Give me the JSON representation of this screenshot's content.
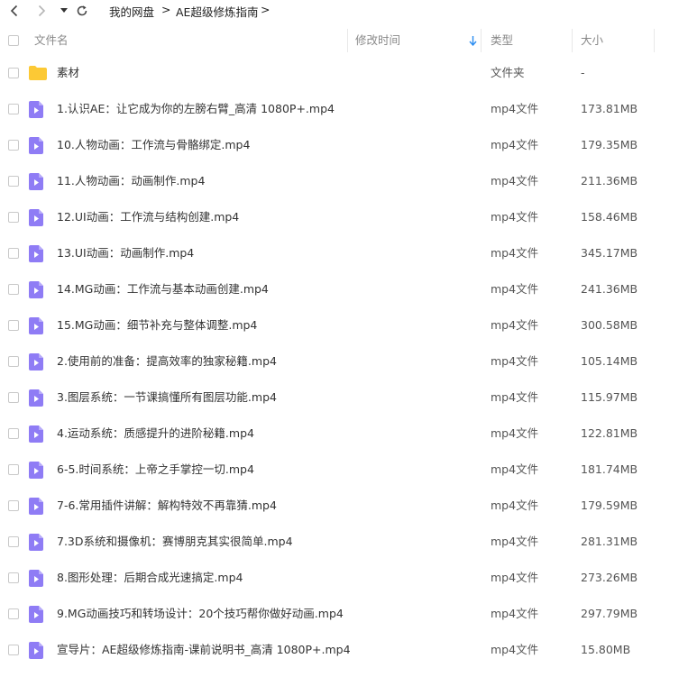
{
  "breadcrumb": [
    "我的网盘",
    "AE超级修炼指南"
  ],
  "breadcrumb_sep": ">",
  "columns": {
    "name": "文件名",
    "modified": "修改时间",
    "type": "类型",
    "size": "大小"
  },
  "accent_color": "#2a8cf0",
  "video_icon_color": "#8f7cf5",
  "folder_icon_color": "#fcc935",
  "rows": [
    {
      "icon": "folder-icon",
      "name": "素材",
      "type": "文件夹",
      "size": "-"
    },
    {
      "icon": "video-file-icon",
      "name": "1.认识AE：让它成为你的左膀右臂_高清 1080P+.mp4",
      "type": "mp4文件",
      "size": "173.81MB"
    },
    {
      "icon": "video-file-icon",
      "name": "10.人物动画：工作流与骨骼绑定.mp4",
      "type": "mp4文件",
      "size": "179.35MB"
    },
    {
      "icon": "video-file-icon",
      "name": "11.人物动画：动画制作.mp4",
      "type": "mp4文件",
      "size": "211.36MB"
    },
    {
      "icon": "video-file-icon",
      "name": "12.UI动画：工作流与结构创建.mp4",
      "type": "mp4文件",
      "size": "158.46MB"
    },
    {
      "icon": "video-file-icon",
      "name": "13.UI动画：动画制作.mp4",
      "type": "mp4文件",
      "size": "345.17MB"
    },
    {
      "icon": "video-file-icon",
      "name": "14.MG动画：工作流与基本动画创建.mp4",
      "type": "mp4文件",
      "size": "241.36MB"
    },
    {
      "icon": "video-file-icon",
      "name": "15.MG动画：细节补充与整体调整.mp4",
      "type": "mp4文件",
      "size": "300.58MB"
    },
    {
      "icon": "video-file-icon",
      "name": "2.使用前的准备：提高效率的独家秘籍.mp4",
      "type": "mp4文件",
      "size": "105.14MB"
    },
    {
      "icon": "video-file-icon",
      "name": "3.图层系统：一节课搞懂所有图层功能.mp4",
      "type": "mp4文件",
      "size": "115.97MB"
    },
    {
      "icon": "video-file-icon",
      "name": "4.运动系统：质感提升的进阶秘籍.mp4",
      "type": "mp4文件",
      "size": "122.81MB"
    },
    {
      "icon": "video-file-icon",
      "name": "6-5.时间系统：上帝之手掌控一切.mp4",
      "type": "mp4文件",
      "size": "181.74MB"
    },
    {
      "icon": "video-file-icon",
      "name": "7-6.常用插件讲解：解构特效不再靠猜.mp4",
      "type": "mp4文件",
      "size": "179.59MB"
    },
    {
      "icon": "video-file-icon",
      "name": "7.3D系统和摄像机：赛博朋克其实很简单.mp4",
      "type": "mp4文件",
      "size": "281.31MB"
    },
    {
      "icon": "video-file-icon",
      "name": "8.图形处理：后期合成光速搞定.mp4",
      "type": "mp4文件",
      "size": "273.26MB"
    },
    {
      "icon": "video-file-icon",
      "name": "9.MG动画技巧和转场设计：20个技巧帮你做好动画.mp4",
      "type": "mp4文件",
      "size": "297.79MB"
    },
    {
      "icon": "video-file-icon",
      "name": "宣导片：AE超级修炼指南-课前说明书_高清 1080P+.mp4",
      "type": "mp4文件",
      "size": "15.80MB"
    }
  ]
}
